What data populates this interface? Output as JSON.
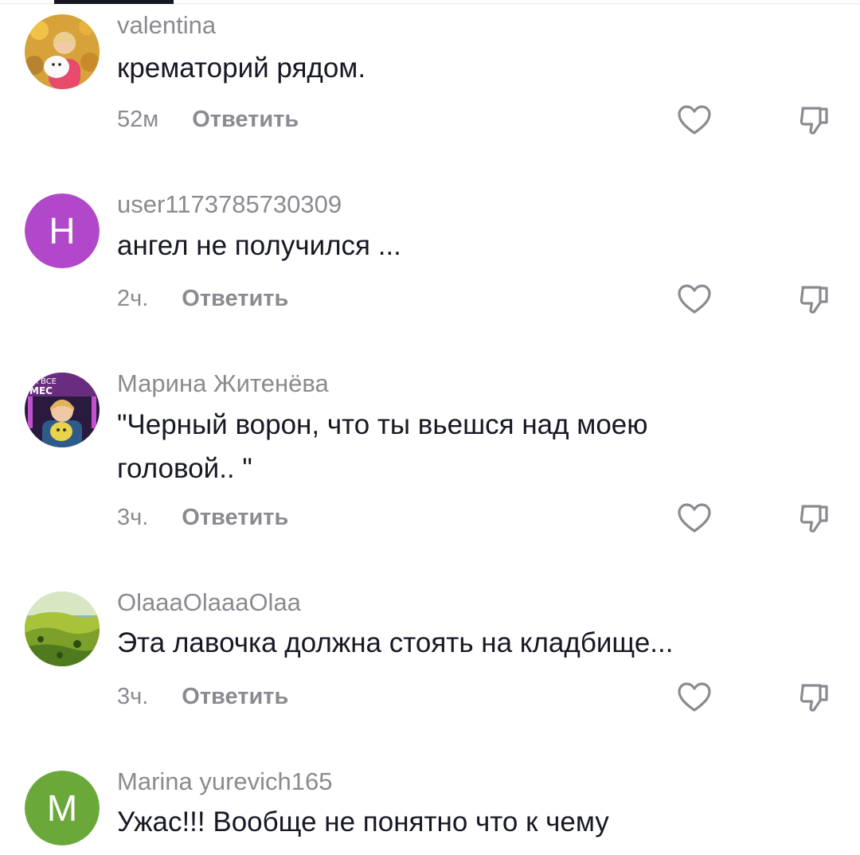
{
  "comments": [
    {
      "username": "valentina",
      "text": "крематорий рядом.",
      "time": "52м",
      "reply_label": "Ответить",
      "avatar": {
        "type": "photo",
        "subject": "woman-with-white-dog-flowers"
      }
    },
    {
      "username": "user1173785730309",
      "text": "ангел не получился ...",
      "time": "2ч.",
      "reply_label": "Ответить",
      "avatar": {
        "type": "letter",
        "letter": "H",
        "color": "#b148c9"
      }
    },
    {
      "username": "Марина Житенёва",
      "text": "\"Черный ворон, что ты вьешся над моею головой.. \"",
      "time": "3ч.",
      "reply_label": "Ответить",
      "avatar": {
        "type": "photo",
        "subject": "woman-with-toy-stage"
      }
    },
    {
      "username": "OlaaaOlaaaOlaa",
      "text": "Эта лавочка должна стоять на кладбище...",
      "time": "3ч.",
      "reply_label": "Ответить",
      "avatar": {
        "type": "photo",
        "subject": "green-hills-landscape"
      }
    },
    {
      "username": "Marina yurevich165",
      "text": "Ужас!!! Вообще не понятно что к чему",
      "time": "",
      "reply_label": "",
      "avatar": {
        "type": "letter",
        "letter": "M",
        "color": "#6aa83a"
      }
    }
  ],
  "icons": {
    "like": "heart-outline-icon",
    "dislike": "thumbs-down-outline-icon"
  },
  "colors": {
    "text_primary": "#161823",
    "text_secondary": "#8a8b91",
    "background": "#ffffff"
  }
}
